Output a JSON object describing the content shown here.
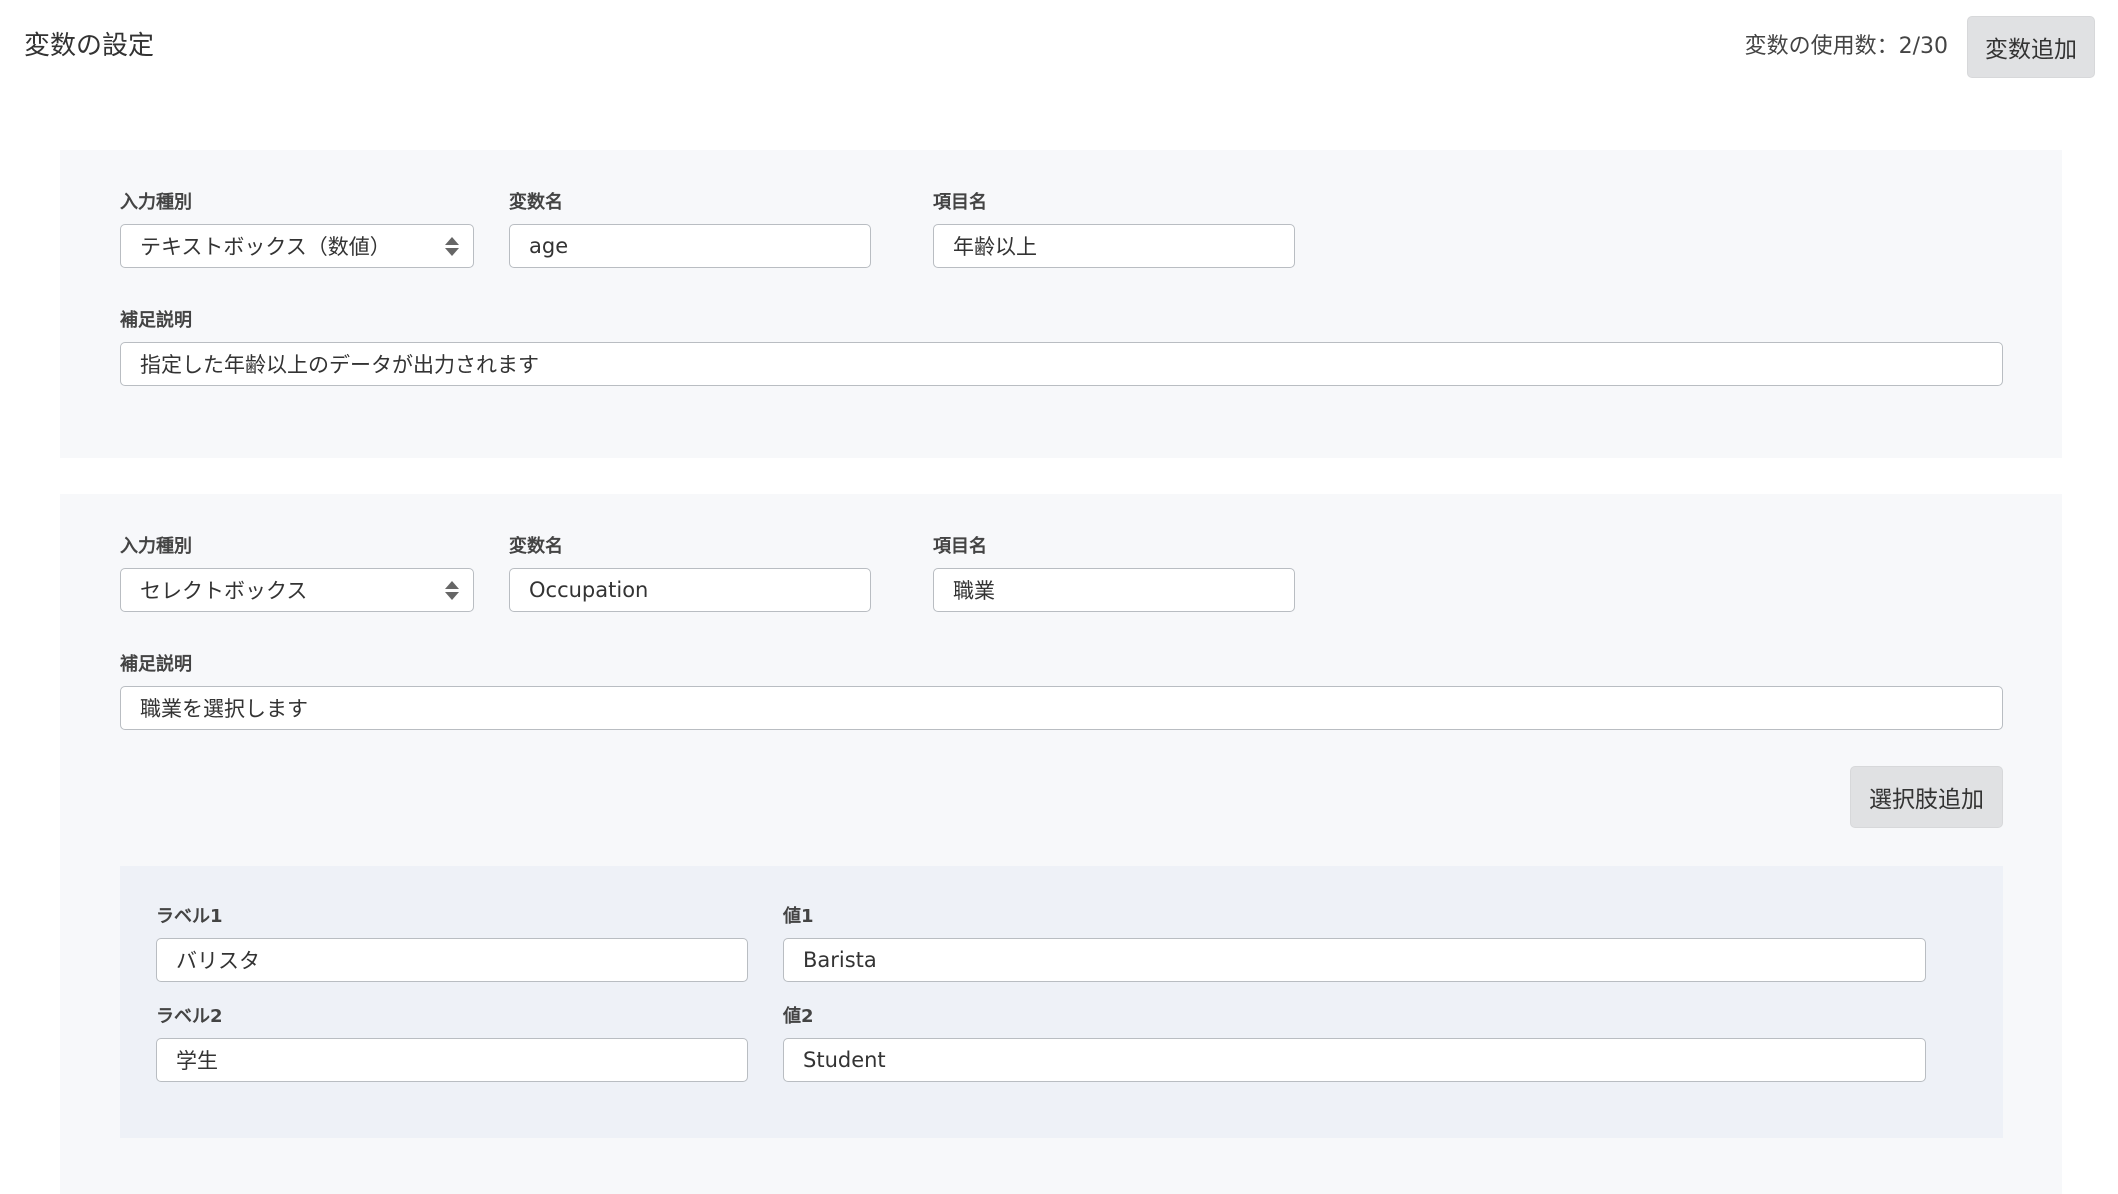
{
  "header": {
    "title": "変数の設定",
    "usage_text": "変数の使用数：2/30",
    "add_variable_label": "変数追加"
  },
  "variables": [
    {
      "input_type_label": "入力種別",
      "input_type_value": "テキストボックス（数値）",
      "var_name_label": "変数名",
      "var_name_value": "age",
      "item_name_label": "項目名",
      "item_name_value": "年齢以上",
      "note_label": "補足説明",
      "note_value": "指定した年齢以上のデータが出力されます"
    },
    {
      "input_type_label": "入力種別",
      "input_type_value": "セレクトボックス",
      "var_name_label": "変数名",
      "var_name_value": "Occupation",
      "item_name_label": "項目名",
      "item_name_value": "職業",
      "note_label": "補足説明",
      "note_value": "職業を選択します",
      "add_choice_label": "選択肢追加",
      "choices": [
        {
          "label_caption": "ラベル1",
          "label_value": "バリスタ",
          "value_caption": "値1",
          "value_value": "Barista"
        },
        {
          "label_caption": "ラベル2",
          "label_value": "学生",
          "value_caption": "値2",
          "value_value": "Student"
        }
      ]
    }
  ]
}
